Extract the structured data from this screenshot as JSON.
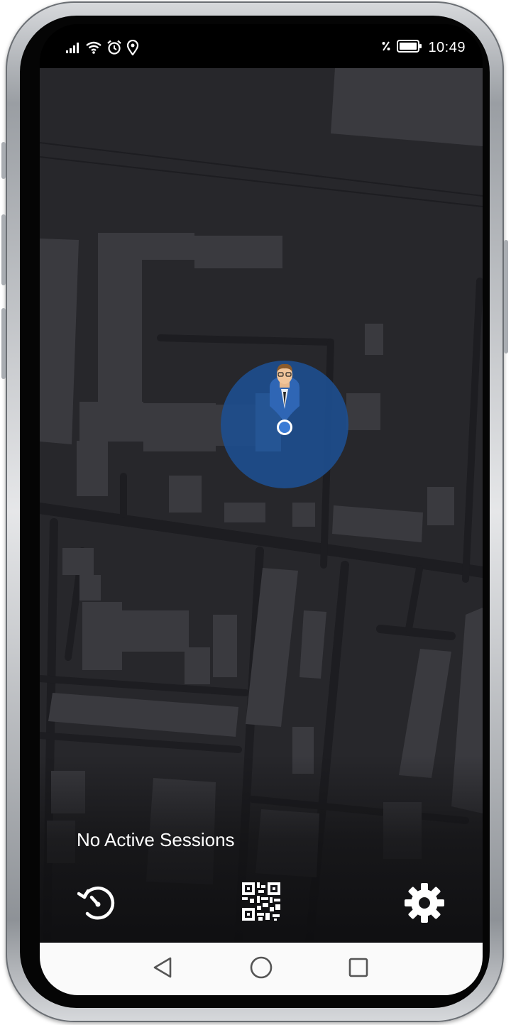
{
  "status_bar": {
    "time": "10:49",
    "left_icons": [
      "signal-icon",
      "wifi-icon",
      "alarm-icon",
      "location-icon"
    ],
    "right_icons": [
      "data-saver-icon",
      "battery-icon"
    ]
  },
  "map": {
    "background": "#27272b",
    "user_marker": {
      "icon": "user-avatar-icon",
      "accuracy_color": "#1e4f8f",
      "dot_color": "#3a7bd5"
    }
  },
  "session": {
    "status_text": "No Active Sessions"
  },
  "actions": {
    "history_icon": "history-icon",
    "qr_icon": "qr-code-icon",
    "settings_icon": "gear-icon"
  },
  "nav": {
    "back_icon": "back-triangle-icon",
    "home_icon": "home-circle-icon",
    "recents_icon": "recents-square-icon"
  }
}
